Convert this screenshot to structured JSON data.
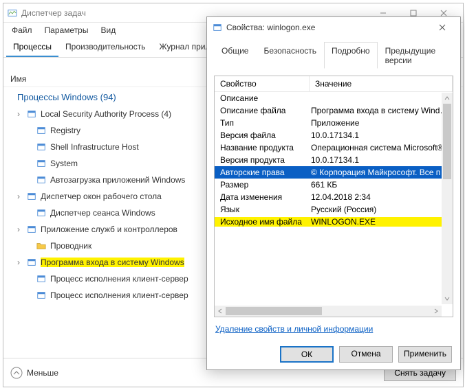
{
  "task_manager": {
    "title": "Диспетчер задач",
    "menu": {
      "file": "Файл",
      "options": "Параметры",
      "view": "Вид"
    },
    "tabs": {
      "processes": "Процессы",
      "performance": "Производительность",
      "app_history": "Журнал прилож"
    },
    "col_name": "Имя",
    "group_label": "Процессы Windows (94)",
    "rows": [
      {
        "label": "Local Security Authority Process (4)",
        "expandable": true,
        "indent": false,
        "hl": false,
        "icon": "app"
      },
      {
        "label": "Registry",
        "expandable": false,
        "indent": true,
        "hl": false,
        "icon": "app"
      },
      {
        "label": "Shell Infrastructure Host",
        "expandable": false,
        "indent": true,
        "hl": false,
        "icon": "app"
      },
      {
        "label": "System",
        "expandable": false,
        "indent": true,
        "hl": false,
        "icon": "app"
      },
      {
        "label": "Автозагрузка приложений Windows",
        "expandable": false,
        "indent": true,
        "hl": false,
        "icon": "app"
      },
      {
        "label": "Диспетчер окон рабочего стола",
        "expandable": true,
        "indent": false,
        "hl": false,
        "icon": "app"
      },
      {
        "label": "Диспетчер сеанса  Windows",
        "expandable": false,
        "indent": true,
        "hl": false,
        "icon": "app"
      },
      {
        "label": "Приложение служб и контроллеров",
        "expandable": true,
        "indent": false,
        "hl": false,
        "icon": "app"
      },
      {
        "label": "Проводник",
        "expandable": false,
        "indent": true,
        "hl": false,
        "icon": "folder"
      },
      {
        "label": "Программа входа в систему Windows",
        "expandable": true,
        "indent": false,
        "hl": true,
        "icon": "app"
      },
      {
        "label": "Процесс исполнения клиент-сервер",
        "expandable": false,
        "indent": true,
        "hl": false,
        "icon": "app"
      },
      {
        "label": "Процесс исполнения клиент-сервер",
        "expandable": false,
        "indent": true,
        "hl": false,
        "icon": "app"
      }
    ],
    "fewer": "Меньше",
    "end_task": "Снять задачу"
  },
  "props": {
    "title": "Свойства: winlogon.exe",
    "tabs": {
      "general": "Общие",
      "security": "Безопасность",
      "details": "Подробно",
      "previous": "Предыдущие версии"
    },
    "columns": {
      "property": "Свойство",
      "value": "Значение"
    },
    "section": "Описание",
    "rows": [
      {
        "name": "Описание файла",
        "value": "Программа входа в систему Windows",
        "sel": false,
        "hl": false
      },
      {
        "name": "Тип",
        "value": "Приложение",
        "sel": false,
        "hl": false
      },
      {
        "name": "Версия файла",
        "value": "10.0.17134.1",
        "sel": false,
        "hl": false
      },
      {
        "name": "Название продукта",
        "value": "Операционная система Microsoft® W…",
        "sel": false,
        "hl": false
      },
      {
        "name": "Версия продукта",
        "value": "10.0.17134.1",
        "sel": false,
        "hl": false
      },
      {
        "name": "Авторские права",
        "value": "© Корпорация Майкрософт. Все пра…",
        "sel": true,
        "hl": false
      },
      {
        "name": "Размер",
        "value": "661 КБ",
        "sel": false,
        "hl": false
      },
      {
        "name": "Дата изменения",
        "value": "12.04.2018 2:34",
        "sel": false,
        "hl": false
      },
      {
        "name": "Язык",
        "value": "Русский (Россия)",
        "sel": false,
        "hl": false
      },
      {
        "name": "Исходное имя файла",
        "value": "WINLOGON.EXE",
        "sel": false,
        "hl": true
      }
    ],
    "link": "Удаление свойств и личной информации",
    "buttons": {
      "ok": "ОК",
      "cancel": "Отмена",
      "apply": "Применить"
    }
  }
}
